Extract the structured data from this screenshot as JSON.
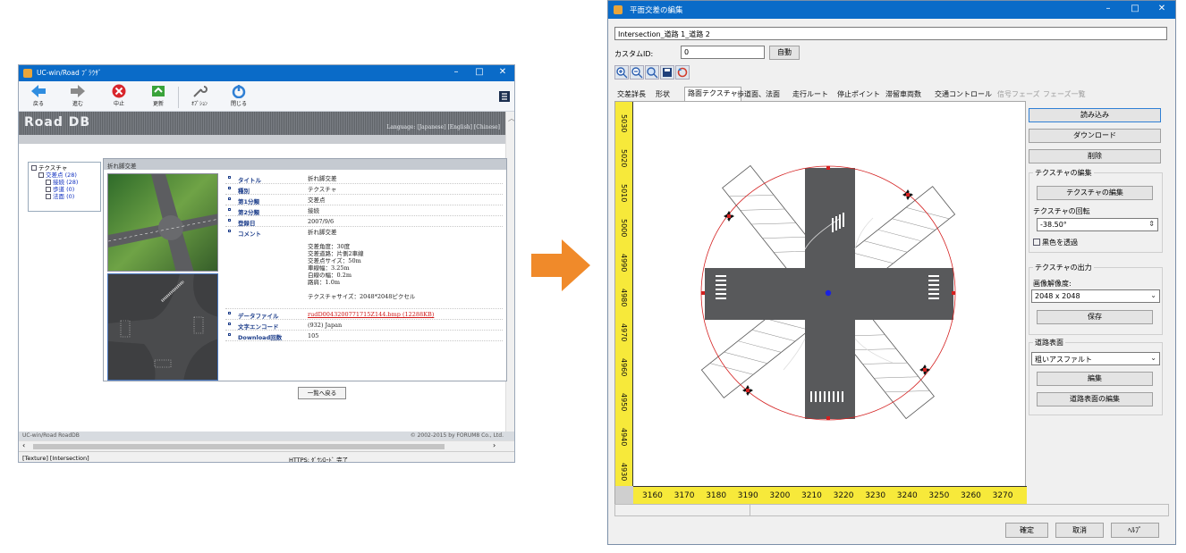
{
  "browser": {
    "title": "UC-win/Road ﾌﾞﾗｳｻﾞ",
    "window_controls": [
      "–",
      "□",
      "✕"
    ],
    "toolbar": [
      {
        "label": "戻る",
        "icon": "back-arrow-icon",
        "color": "#2f8de0"
      },
      {
        "label": "進む",
        "icon": "forward-arrow-icon",
        "color": "#8a8a8a"
      },
      {
        "label": "中止",
        "icon": "stop-icon",
        "color": "#d8262c"
      },
      {
        "label": "更新",
        "icon": "refresh-icon",
        "color": "#3aa33a"
      },
      {
        "label": "ｵﾌﾟｼｮﾝ",
        "icon": "wrench-icon",
        "color": "#6a6a6a"
      },
      {
        "label": "閉じる",
        "icon": "power-icon",
        "color": "#2f7fd4"
      }
    ],
    "logo": "Road DB",
    "languages": "Language: [Japanese]  [English]  [Chinese]",
    "tree": {
      "root": "テクスチャ",
      "child": "交差点 (28)",
      "leaves": [
        "接続 (28)",
        "歩道 (0)",
        "法面 (0)"
      ]
    },
    "card_title": "折れ脚交差",
    "properties": [
      {
        "key": "タイトル",
        "value": "折れ脚交差"
      },
      {
        "key": "種別",
        "value": "テクスチャ"
      },
      {
        "key": "第1分類",
        "value": "交差点"
      },
      {
        "key": "第2分類",
        "value": "接続"
      },
      {
        "key": "登録日",
        "value": "2007/9/6"
      },
      {
        "key": "コメント",
        "value": "折れ脚交差\n\n交差角度：30度\n交差道路：片側2車線\n交差点サイズ：50m\n車線幅：3.25m\n白線の幅：0.2m\n路肩：1.0m\n\nテクスチャサイズ：2048*2048ピクセル"
      },
      {
        "key": "データファイル",
        "value": "rudD0043200771715Z144.bmp (12288KB)"
      },
      {
        "key": "文字エンコード",
        "value": "(932) Japan"
      },
      {
        "key": "Download回数",
        "value": "105"
      }
    ],
    "back_button": "一覧へ戻る",
    "footer_left": "UC-win/Road RoadDB",
    "footer_right": "© 2002-2015 by FORUM8 Co., Ltd.",
    "status_left": "[Texture] [Intersection]",
    "status_mid": "HTTPS: ﾀﾞｳﾝﾛｰﾄﾞ 完了"
  },
  "arrow_color": "#f08a2a",
  "dialog": {
    "title": "平面交差の編集",
    "window_controls": [
      "–",
      "□",
      "✕"
    ],
    "name_value": "Intersection_道路 1_道路 2",
    "custom_id_label": "カスタムID:",
    "custom_id_value": "0",
    "auto_button": "自動",
    "tool_icons": [
      "zoom-in-icon",
      "zoom-out-icon",
      "zoom-fit-icon",
      "save-icon",
      "reset-icon"
    ],
    "tabs": [
      "交差詳長",
      "形状",
      "路面テクスチャ",
      "歩道面、法面",
      "走行ルート",
      "停止ポイント",
      "滞留車両数",
      "交通コントロール",
      "信号フェーズ",
      "フェーズ一覧"
    ],
    "active_tab": "路面テクスチャ",
    "disabled_tabs": [
      "信号フェーズ",
      "フェーズ一覧"
    ],
    "ruler_y": [
      "5030",
      "5020",
      "5010",
      "5000",
      "4990",
      "4980",
      "4970",
      "4960",
      "4950",
      "4940",
      "4930"
    ],
    "ruler_x": [
      "3160",
      "3170",
      "3180",
      "3190",
      "3200",
      "3210",
      "3220",
      "3230",
      "3240",
      "3250",
      "3260",
      "3270"
    ],
    "side": {
      "load_button": "読み込み",
      "download_button": "ダウンロード",
      "delete_button": "削除",
      "edit_group": "テクスチャの編集",
      "edit_button": "テクスチャの編集",
      "rotation_label": "テクスチャの回転",
      "rotation_value": "-38.50°",
      "transparent_label": "黒色を透過",
      "output_group": "テクスチャの出力",
      "resolution_label": "画像解像度:",
      "resolution_value": "2048 x 2048",
      "save_button": "保存",
      "surface_group": "道路表面",
      "surface_value": "粗いアスファルト",
      "surface_edit_button": "編集",
      "surface_edit2_button": "道路表面の編集"
    },
    "ok_button": "確定",
    "cancel_button": "取消",
    "help_button": "ﾍﾙﾌﾟ"
  }
}
